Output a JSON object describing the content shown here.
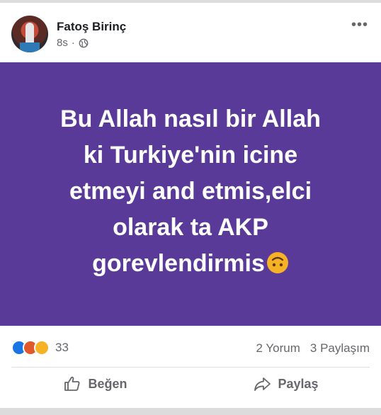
{
  "post": {
    "author": "Fatoş Birinç",
    "time": "8s",
    "separator": "·",
    "privacy_icon": "globe-icon",
    "more_icon": "more-options-icon",
    "more_glyph": "•••",
    "background_color": "#5a3a98",
    "text_lines": [
      "Bu Allah nasıl bir Allah",
      "ki Turkiye'nin icine",
      "etmeyi and etmis,elci",
      "olarak ta AKP",
      "gorevlendirmis"
    ],
    "trailing_emoji": "upside-down-face-emoji"
  },
  "stats": {
    "reaction_icons": [
      "like-reaction-icon",
      "angry-reaction-icon",
      "haha-reaction-icon"
    ],
    "reaction_count": "33",
    "comments": "2 Yorum",
    "shares": "3 Paylaşım"
  },
  "actions": {
    "like_label": "Beğen",
    "share_label": "Paylaş"
  }
}
